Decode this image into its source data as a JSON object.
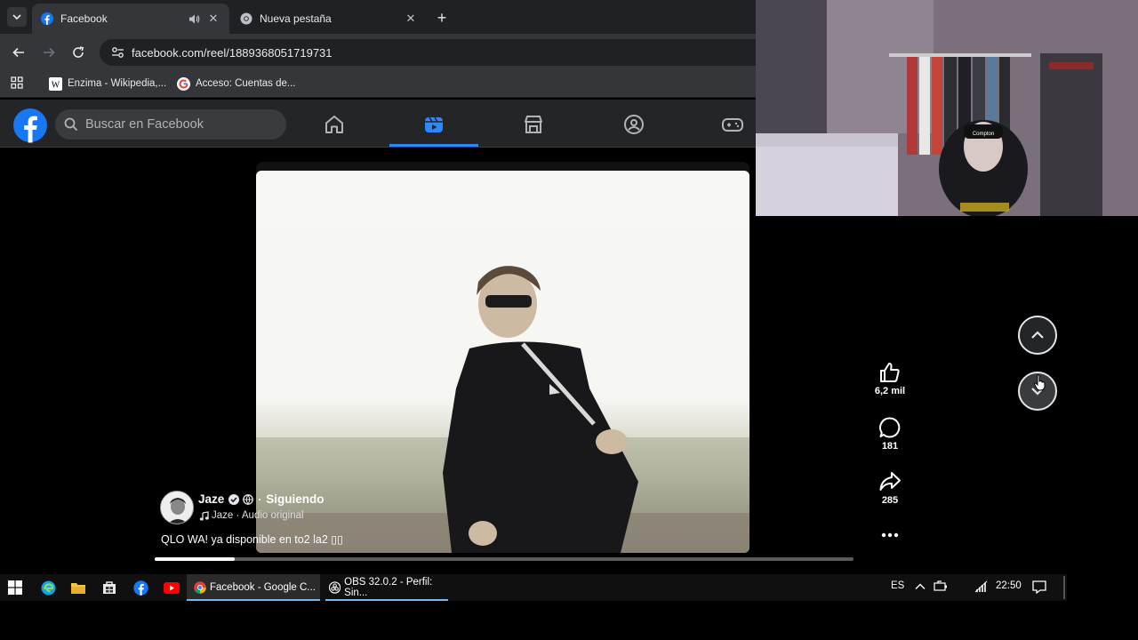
{
  "browser": {
    "tabs": [
      {
        "title": "Facebook",
        "active": true
      },
      {
        "title": "Nueva pestaña",
        "active": false
      }
    ],
    "new_tab_symbol": "+",
    "url": "facebook.com/reel/1889368051719731",
    "bookmarks": [
      {
        "label": "Enzima - Wikipedia,...",
        "icon": "wikipedia-icon"
      },
      {
        "label": "Acceso: Cuentas de...",
        "icon": "google-icon"
      }
    ]
  },
  "facebook": {
    "search_placeholder": "Buscar en Facebook",
    "nav": [
      "home-icon",
      "reels-icon",
      "marketplace-icon",
      "groups-icon",
      "gaming-icon"
    ],
    "accent": "#2d88ff",
    "reel": {
      "author": "Jaze",
      "follow_status": "Siguiendo",
      "audio": "Jaze · Audio original",
      "caption": "QLO WA! ya disponible en to2 la2 ▯▯",
      "likes": "6,2 mil",
      "comments": "181",
      "shares": "285",
      "progress": 0.115
    }
  },
  "taskbar": {
    "apps": [
      {
        "label": "Facebook - Google C...",
        "active": true
      },
      {
        "label": "OBS 32.0.2 - Perfil: Sin...",
        "active": false
      }
    ],
    "language": "ES",
    "time": "22:50"
  }
}
